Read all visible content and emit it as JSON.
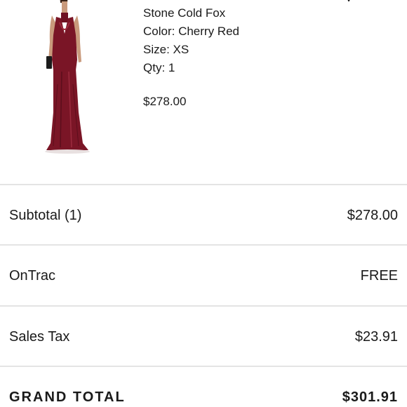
{
  "product": {
    "brand": "Stone Cold Fox",
    "color": "Color: Cherry Red",
    "size": "Size: XS",
    "qty": "Qty: 1",
    "price": "$278.00",
    "image_icon": "dress-product-image"
  },
  "summary": {
    "subtotal_label": "Subtotal (1)",
    "subtotal_value": "$278.00",
    "shipping_label": "OnTrac",
    "shipping_value": "FREE",
    "tax_label": "Sales Tax",
    "tax_value": "$23.91",
    "grand_total_label": "GRAND TOTAL",
    "grand_total_value": "$301.91"
  },
  "colors": {
    "dress": "#7a1526",
    "divider": "#e4e4e4",
    "text": "#1a1a1a"
  }
}
